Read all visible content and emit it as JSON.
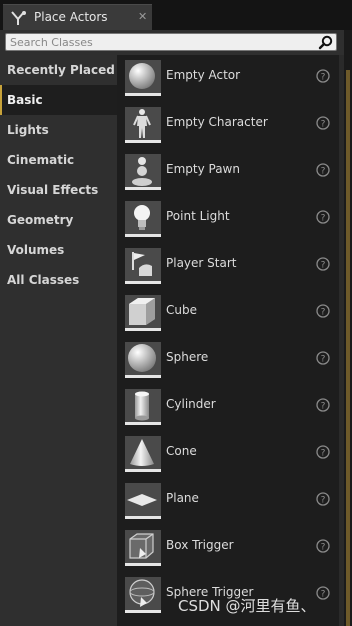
{
  "tab": {
    "title": "Place Actors",
    "close": "✕"
  },
  "search": {
    "placeholder": "Search Classes"
  },
  "categories": [
    {
      "label": "Recently Placed",
      "active": false
    },
    {
      "label": "Basic",
      "active": true
    },
    {
      "label": "Lights",
      "active": false
    },
    {
      "label": "Cinematic",
      "active": false
    },
    {
      "label": "Visual Effects",
      "active": false
    },
    {
      "label": "Geometry",
      "active": false
    },
    {
      "label": "Volumes",
      "active": false
    },
    {
      "label": "All Classes",
      "active": false
    }
  ],
  "actors": [
    {
      "label": "Empty Actor",
      "icon": "sphere-icon"
    },
    {
      "label": "Empty Character",
      "icon": "character-icon"
    },
    {
      "label": "Empty Pawn",
      "icon": "pawn-icon"
    },
    {
      "label": "Point Light",
      "icon": "light-bulb-icon"
    },
    {
      "label": "Player Start",
      "icon": "flag-icon"
    },
    {
      "label": "Cube",
      "icon": "cube-icon"
    },
    {
      "label": "Sphere",
      "icon": "sphere-icon"
    },
    {
      "label": "Cylinder",
      "icon": "cylinder-icon"
    },
    {
      "label": "Cone",
      "icon": "cone-icon"
    },
    {
      "label": "Plane",
      "icon": "plane-icon"
    },
    {
      "label": "Box Trigger",
      "icon": "box-trigger-icon"
    },
    {
      "label": "Sphere Trigger",
      "icon": "sphere-trigger-icon"
    }
  ],
  "watermark": "CSDN @河里有鱼、",
  "colors": {
    "accent": "#c7a23a",
    "panel": "#2f2f2f",
    "list": "#1d1d1d"
  }
}
